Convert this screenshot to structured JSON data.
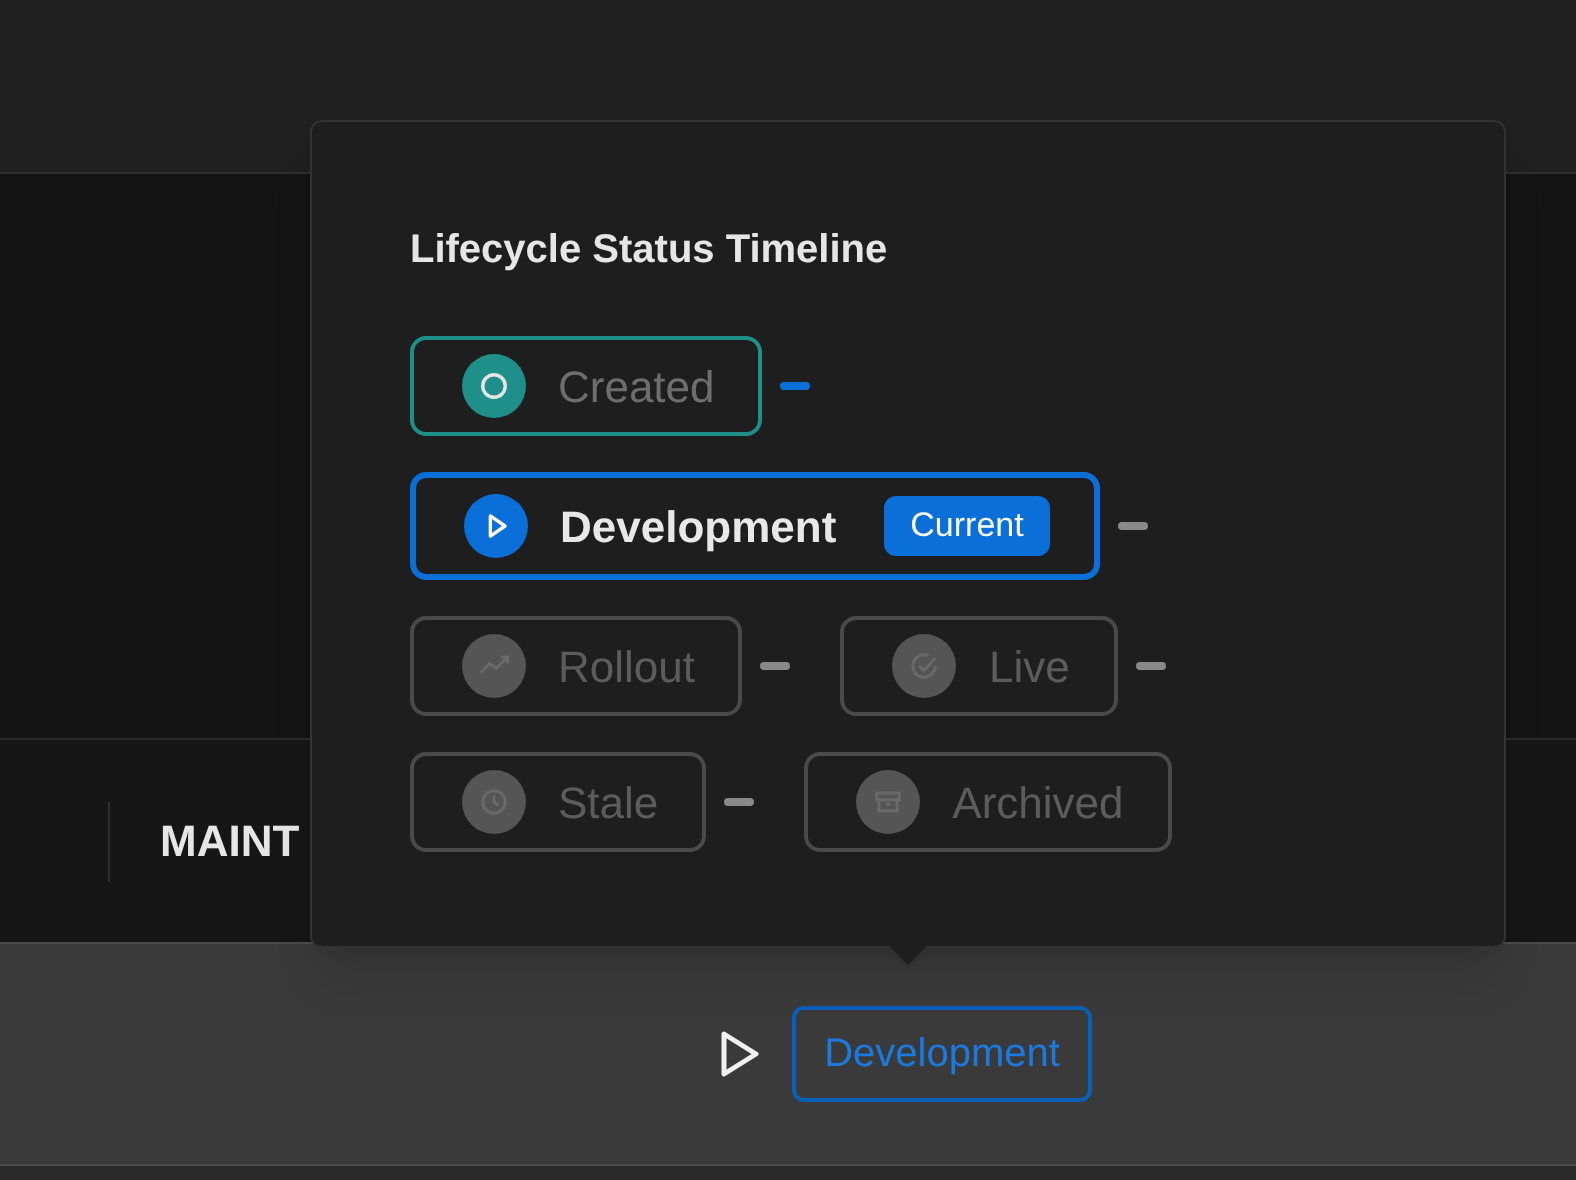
{
  "background_label": "MAINT",
  "popover": {
    "title": "Lifecycle Status Timeline",
    "stages": [
      {
        "label": "Created",
        "completed": true,
        "selected": false
      },
      {
        "label": "Development",
        "completed": false,
        "selected": true,
        "badge": "Current"
      },
      {
        "label": "Rollout",
        "completed": false,
        "selected": false
      },
      {
        "label": "Live",
        "completed": false,
        "selected": false
      },
      {
        "label": "Stale",
        "completed": false,
        "selected": false
      },
      {
        "label": "Archived",
        "completed": false,
        "selected": false
      }
    ]
  },
  "status_chip": {
    "label": "Development"
  }
}
